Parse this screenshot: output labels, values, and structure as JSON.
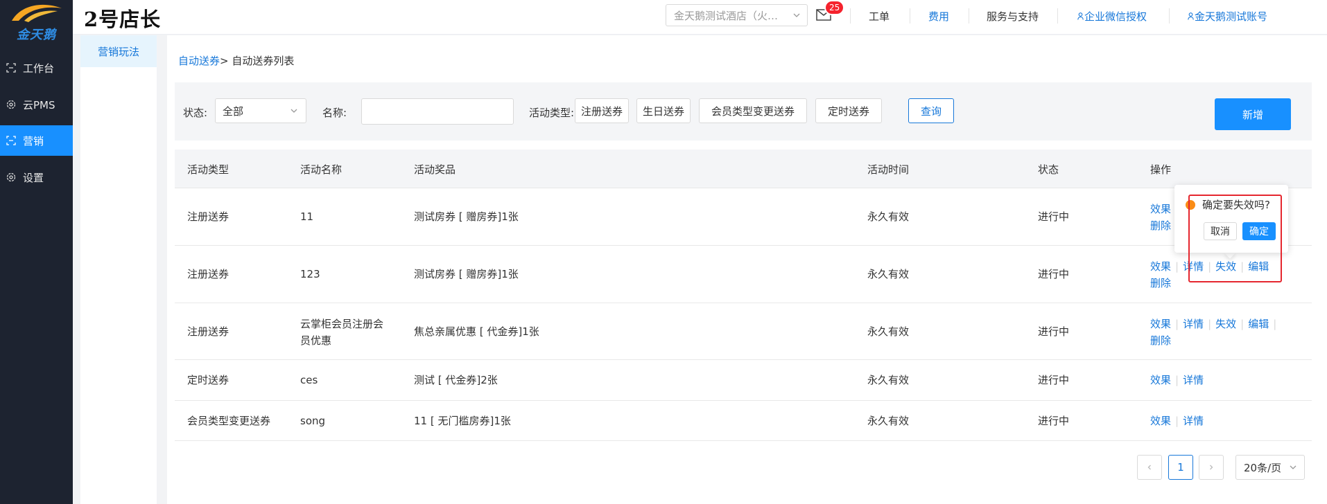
{
  "colors": {
    "primary": "#1890ff",
    "link": "#1677d9",
    "nav_bg": "#1d2330",
    "highlight": "#e5262e",
    "warning": "#fa8c16"
  },
  "logo": {
    "text": "金天鹅"
  },
  "nav": [
    {
      "label": "工作台",
      "icon": "workbench-icon"
    },
    {
      "label": "云PMS",
      "icon": "gear-icon"
    },
    {
      "label": "营销",
      "icon": "marketing-icon",
      "active": true
    },
    {
      "label": "设置",
      "icon": "gear-icon"
    }
  ],
  "header": {
    "brand": "2号店长",
    "hotel_select": "金天鹅测试酒店（火…",
    "mail_badge": "25",
    "links": {
      "work_order": "工单",
      "fees": "费用",
      "service": "服务与支持",
      "wechat": "企业微信授权",
      "account": "金天鹅测试账号"
    }
  },
  "subnav": {
    "item": "营销玩法"
  },
  "breadcrumb": {
    "link": "自动送券",
    "sep": ">",
    "current": " 自动送券列表"
  },
  "filter": {
    "status_label": "状态:",
    "status_value": "全部",
    "name_label": "名称:",
    "name_value": "",
    "type_label": "活动类型:",
    "type_buttons": [
      "注册送券",
      "生日送券",
      "会员类型变更送券",
      "定时送券"
    ],
    "query": "查询",
    "add": "新增"
  },
  "table": {
    "columns": [
      "活动类型",
      "活动名称",
      "活动奖品",
      "活动时间",
      "状态",
      "操作"
    ],
    "rows": [
      {
        "type": "注册送券",
        "name": "11",
        "name2": "",
        "prize": "测试房券 [ 赠房券]1张",
        "time": "永久有效",
        "status": "进行中",
        "ops": [
          "效果",
          "删除"
        ]
      },
      {
        "type": "注册送券",
        "name": "123",
        "name2": "",
        "prize": "测试房券 [ 赠房券]1张",
        "time": "永久有效",
        "status": "进行中",
        "ops": [
          "效果",
          "详情",
          "失效",
          "编辑",
          "删除"
        ]
      },
      {
        "type": "注册送券",
        "name": "云掌柜会员注册会",
        "name2": "员优惠",
        "prize": "焦总亲属优惠 [ 代金券]1张",
        "time": "永久有效",
        "status": "进行中",
        "ops": [
          "效果",
          "详情",
          "失效",
          "编辑",
          "删除"
        ]
      },
      {
        "type": "定时送券",
        "name": "ces",
        "name2": "",
        "prize": "测试 [ 代金券]2张",
        "time": "永久有效",
        "status": "进行中",
        "ops": [
          "效果",
          "详情"
        ]
      },
      {
        "type": "会员类型变更送券",
        "name": "song",
        "name2": "",
        "prize": "11 [ 无门槛房券]1张",
        "time": "永久有效",
        "status": "进行中",
        "ops": [
          "效果",
          "详情"
        ]
      }
    ]
  },
  "popconfirm": {
    "text": "确定要失效吗?",
    "cancel": "取消",
    "ok": "确定"
  },
  "pagination": {
    "current": "1",
    "page_size": "20条/页"
  }
}
